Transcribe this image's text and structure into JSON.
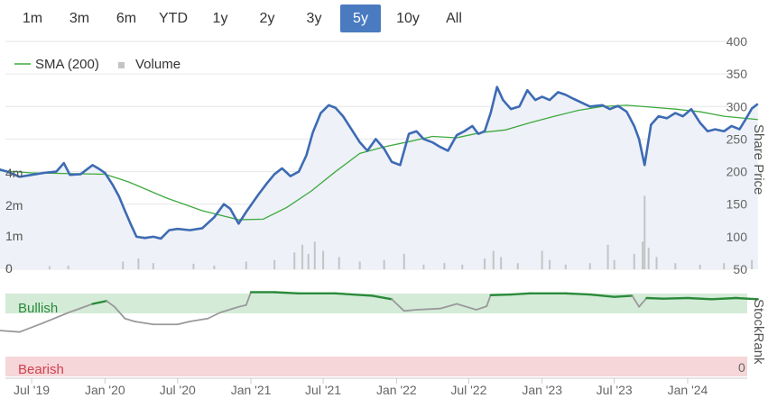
{
  "range_selector": {
    "buttons": [
      "1m",
      "3m",
      "6m",
      "YTD",
      "1y",
      "2y",
      "3y",
      "5y",
      "10y",
      "All"
    ],
    "active": "5y"
  },
  "colors": {
    "price_line": "#3d6bb3",
    "price_fill": "#eef1f8",
    "sma_line": "#3daa3d",
    "volume_bar": "#c4c4c4",
    "stockrank_bullish": "#2a8a3a",
    "stockrank_neutral": "#9a9a9a",
    "bullish_band": "#d4ebd8",
    "bearish_band": "#f6d6d8",
    "bullish_text": "#2a8a3a",
    "bearish_text": "#d04050",
    "active_button": "#4a7bc0"
  },
  "chart_data": {
    "type": "line",
    "legend": [
      "SMA (200)",
      "Volume"
    ],
    "x_tick_labels": [
      "Jul '19",
      "Jan '20",
      "Jul '20",
      "Jan '21",
      "Jul '21",
      "Jan '22",
      "Jul '22",
      "Jan '23",
      "Jul '23",
      "Jan '24"
    ],
    "x_tick_values": [
      "2019-07-01",
      "2020-01-01",
      "2020-07-01",
      "2021-01-01",
      "2021-07-01",
      "2022-01-01",
      "2022-07-01",
      "2023-01-01",
      "2023-07-01",
      "2024-01-01"
    ],
    "price_axis": {
      "title": "Share Price",
      "ticks": [
        50,
        100,
        150,
        200,
        250,
        300,
        350,
        400
      ],
      "ylim": [
        50,
        400
      ]
    },
    "volume_axis": {
      "tick_labels": [
        "0",
        "1m",
        "2m",
        "4m"
      ]
    },
    "stockrank_axis": {
      "title": "StockRank",
      "min_label": "0",
      "bands": {
        "bullish": "Bullish",
        "bearish": "Bearish"
      }
    },
    "series": [
      {
        "name": "Share Price",
        "points": [
          [
            "2019-04-01",
            205
          ],
          [
            "2019-05-01",
            200
          ],
          [
            "2019-06-01",
            192
          ],
          [
            "2019-07-01",
            195
          ],
          [
            "2019-08-01",
            198
          ],
          [
            "2019-09-01",
            200
          ],
          [
            "2019-09-20",
            213
          ],
          [
            "2019-10-05",
            195
          ],
          [
            "2019-11-01",
            196
          ],
          [
            "2019-12-01",
            210
          ],
          [
            "2019-12-15",
            205
          ],
          [
            "2020-01-01",
            198
          ],
          [
            "2020-01-20",
            180
          ],
          [
            "2020-02-05",
            162
          ],
          [
            "2020-02-20",
            140
          ],
          [
            "2020-03-05",
            120
          ],
          [
            "2020-03-20",
            100
          ],
          [
            "2020-04-10",
            98
          ],
          [
            "2020-05-01",
            100
          ],
          [
            "2020-05-20",
            97
          ],
          [
            "2020-06-10",
            110
          ],
          [
            "2020-07-01",
            112
          ],
          [
            "2020-08-01",
            110
          ],
          [
            "2020-09-01",
            113
          ],
          [
            "2020-10-01",
            130
          ],
          [
            "2020-10-25",
            150
          ],
          [
            "2020-11-10",
            143
          ],
          [
            "2020-12-01",
            120
          ],
          [
            "2020-12-20",
            138
          ],
          [
            "2021-01-20",
            165
          ],
          [
            "2021-02-10",
            182
          ],
          [
            "2021-03-01",
            196
          ],
          [
            "2021-03-20",
            205
          ],
          [
            "2021-04-10",
            193
          ],
          [
            "2021-05-01",
            200
          ],
          [
            "2021-05-20",
            225
          ],
          [
            "2021-06-05",
            260
          ],
          [
            "2021-06-25",
            290
          ],
          [
            "2021-07-15",
            302
          ],
          [
            "2021-08-01",
            298
          ],
          [
            "2021-08-20",
            285
          ],
          [
            "2021-09-10",
            265
          ],
          [
            "2021-10-01",
            245
          ],
          [
            "2021-10-20",
            232
          ],
          [
            "2021-11-10",
            250
          ],
          [
            "2021-12-01",
            235
          ],
          [
            "2021-12-20",
            215
          ],
          [
            "2022-01-10",
            210
          ],
          [
            "2022-02-01",
            258
          ],
          [
            "2022-02-20",
            262
          ],
          [
            "2022-03-10",
            250
          ],
          [
            "2022-04-01",
            245
          ],
          [
            "2022-04-20",
            238
          ],
          [
            "2022-05-10",
            232
          ],
          [
            "2022-06-01",
            256
          ],
          [
            "2022-06-20",
            262
          ],
          [
            "2022-07-10",
            270
          ],
          [
            "2022-07-25",
            258
          ],
          [
            "2022-08-10",
            262
          ],
          [
            "2022-08-25",
            290
          ],
          [
            "2022-09-10",
            330
          ],
          [
            "2022-09-25",
            310
          ],
          [
            "2022-10-15",
            296
          ],
          [
            "2022-11-05",
            300
          ],
          [
            "2022-11-25",
            325
          ],
          [
            "2022-12-15",
            310
          ],
          [
            "2023-01-01",
            315
          ],
          [
            "2023-01-20",
            310
          ],
          [
            "2023-02-10",
            322
          ],
          [
            "2023-03-01",
            318
          ],
          [
            "2023-03-20",
            312
          ],
          [
            "2023-04-10",
            306
          ],
          [
            "2023-05-01",
            300
          ],
          [
            "2023-06-01",
            302
          ],
          [
            "2023-06-20",
            296
          ],
          [
            "2023-07-10",
            301
          ],
          [
            "2023-08-01",
            292
          ],
          [
            "2023-08-20",
            270
          ],
          [
            "2023-09-01",
            250
          ],
          [
            "2023-09-15",
            210
          ],
          [
            "2023-10-01",
            272
          ],
          [
            "2023-10-20",
            285
          ],
          [
            "2023-11-10",
            282
          ],
          [
            "2023-12-01",
            290
          ],
          [
            "2023-12-20",
            285
          ],
          [
            "2024-01-10",
            296
          ],
          [
            "2024-02-01",
            275
          ],
          [
            "2024-02-20",
            262
          ],
          [
            "2024-03-10",
            265
          ],
          [
            "2024-04-01",
            262
          ],
          [
            "2024-04-20",
            270
          ],
          [
            "2024-05-10",
            265
          ],
          [
            "2024-05-25",
            280
          ],
          [
            "2024-06-10",
            297
          ],
          [
            "2024-06-25",
            304
          ]
        ]
      },
      {
        "name": "SMA (200)",
        "points": [
          [
            "2019-04-01",
            202
          ],
          [
            "2019-07-01",
            198
          ],
          [
            "2019-10-01",
            197
          ],
          [
            "2020-01-01",
            196
          ],
          [
            "2020-03-01",
            184
          ],
          [
            "2020-06-01",
            160
          ],
          [
            "2020-09-01",
            140
          ],
          [
            "2020-12-01",
            126
          ],
          [
            "2021-02-01",
            127
          ],
          [
            "2021-04-01",
            145
          ],
          [
            "2021-06-01",
            170
          ],
          [
            "2021-08-01",
            200
          ],
          [
            "2021-10-01",
            228
          ],
          [
            "2021-12-01",
            238
          ],
          [
            "2022-02-01",
            246
          ],
          [
            "2022-04-01",
            254
          ],
          [
            "2022-06-01",
            252
          ],
          [
            "2022-08-01",
            260
          ],
          [
            "2022-10-01",
            264
          ],
          [
            "2022-12-01",
            275
          ],
          [
            "2023-02-01",
            285
          ],
          [
            "2023-04-01",
            294
          ],
          [
            "2023-06-01",
            300
          ],
          [
            "2023-08-01",
            302
          ],
          [
            "2023-10-01",
            299
          ],
          [
            "2023-12-01",
            296
          ],
          [
            "2024-02-01",
            292
          ],
          [
            "2024-04-01",
            285
          ],
          [
            "2024-06-25",
            280
          ]
        ]
      },
      {
        "name": "StockRank",
        "points": [
          [
            "2019-04-01",
            25
          ],
          [
            "2019-06-01",
            22
          ],
          [
            "2019-08-01",
            38
          ],
          [
            "2019-10-01",
            55
          ],
          [
            "2019-12-01",
            70
          ],
          [
            "2020-01-05",
            75
          ],
          [
            "2020-01-25",
            65
          ],
          [
            "2020-02-20",
            45
          ],
          [
            "2020-03-15",
            40
          ],
          [
            "2020-05-01",
            35
          ],
          [
            "2020-07-01",
            35
          ],
          [
            "2020-08-01",
            40
          ],
          [
            "2020-09-15",
            45
          ],
          [
            "2020-10-15",
            55
          ],
          [
            "2020-12-01",
            65
          ],
          [
            "2020-12-20",
            68
          ],
          [
            "2021-01-01",
            90
          ],
          [
            "2021-03-01",
            90
          ],
          [
            "2021-05-01",
            88
          ],
          [
            "2021-08-01",
            88
          ],
          [
            "2021-11-01",
            84
          ],
          [
            "2021-12-20",
            78
          ],
          [
            "2022-01-20",
            58
          ],
          [
            "2022-02-20",
            60
          ],
          [
            "2022-04-20",
            62
          ],
          [
            "2022-06-01",
            70
          ],
          [
            "2022-07-20",
            60
          ],
          [
            "2022-08-15",
            66
          ],
          [
            "2022-08-25",
            85
          ],
          [
            "2022-10-15",
            86
          ],
          [
            "2022-12-01",
            88
          ],
          [
            "2023-03-01",
            88
          ],
          [
            "2023-05-01",
            86
          ],
          [
            "2023-07-01",
            82
          ],
          [
            "2023-08-15",
            84
          ],
          [
            "2023-09-01",
            65
          ],
          [
            "2023-09-20",
            80
          ],
          [
            "2023-11-01",
            79
          ],
          [
            "2024-01-01",
            80
          ],
          [
            "2024-03-01",
            78
          ],
          [
            "2024-05-01",
            80
          ],
          [
            "2024-06-25",
            78
          ]
        ]
      }
    ],
    "volume": [
      [
        "2019-05-01",
        0.15
      ],
      [
        "2019-08-15",
        0.1
      ],
      [
        "2019-10-01",
        0.12
      ],
      [
        "2020-02-15",
        0.25
      ],
      [
        "2020-03-25",
        0.35
      ],
      [
        "2020-05-01",
        0.2
      ],
      [
        "2020-08-10",
        0.18
      ],
      [
        "2020-10-01",
        0.12
      ],
      [
        "2020-12-20",
        0.25
      ],
      [
        "2021-03-01",
        0.3
      ],
      [
        "2021-04-20",
        0.55
      ],
      [
        "2021-05-10",
        0.8
      ],
      [
        "2021-05-25",
        0.5
      ],
      [
        "2021-06-10",
        0.9
      ],
      [
        "2021-07-01",
        0.6
      ],
      [
        "2021-08-10",
        0.4
      ],
      [
        "2021-10-01",
        0.25
      ],
      [
        "2021-12-01",
        0.3
      ],
      [
        "2022-01-20",
        0.5
      ],
      [
        "2022-03-10",
        0.15
      ],
      [
        "2022-05-01",
        0.2
      ],
      [
        "2022-06-15",
        0.15
      ],
      [
        "2022-08-10",
        0.35
      ],
      [
        "2022-09-01",
        0.6
      ],
      [
        "2022-09-20",
        0.4
      ],
      [
        "2022-11-01",
        0.2
      ],
      [
        "2023-01-01",
        0.6
      ],
      [
        "2023-01-20",
        0.3
      ],
      [
        "2023-03-01",
        0.15
      ],
      [
        "2023-05-01",
        0.2
      ],
      [
        "2023-06-15",
        0.8
      ],
      [
        "2023-07-01",
        0.3
      ],
      [
        "2023-08-20",
        0.5
      ],
      [
        "2023-09-10",
        0.9
      ],
      [
        "2023-09-15",
        2.4
      ],
      [
        "2023-09-25",
        0.7
      ],
      [
        "2023-10-15",
        0.4
      ],
      [
        "2023-12-01",
        0.2
      ],
      [
        "2024-02-01",
        0.15
      ],
      [
        "2024-04-01",
        0.2
      ],
      [
        "2024-06-10",
        0.3
      ]
    ]
  }
}
